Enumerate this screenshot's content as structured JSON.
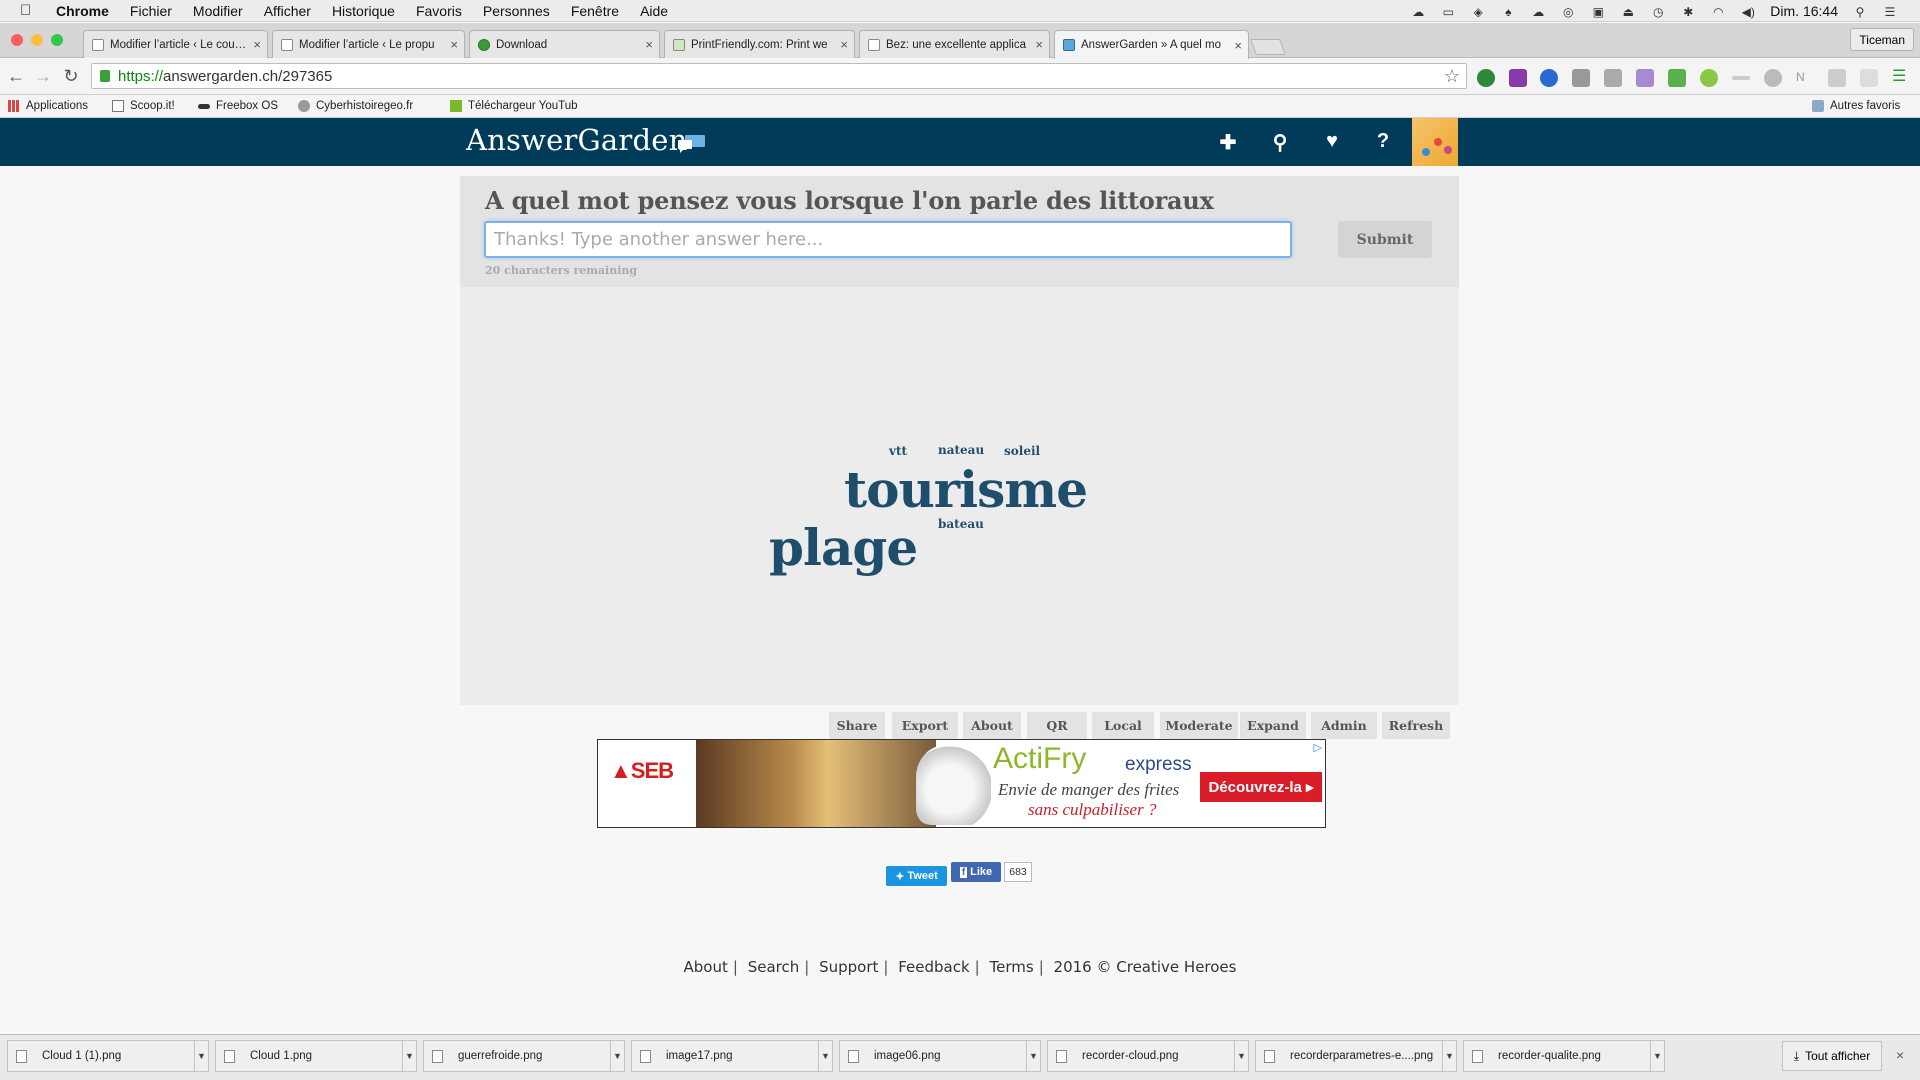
{
  "menubar": {
    "app": "Chrome",
    "items": [
      "Fichier",
      "Modifier",
      "Afficher",
      "Historique",
      "Favoris",
      "Personnes",
      "Fenêtre",
      "Aide"
    ],
    "clock": "Dim. 16:44"
  },
  "tabs": [
    {
      "title": "Modifier l’article ‹ Le coutea"
    },
    {
      "title": "Modifier l’article ‹ Le propu"
    },
    {
      "title": "Download"
    },
    {
      "title": "PrintFriendly.com: Print we"
    },
    {
      "title": "Bez: une excellente applica"
    },
    {
      "title": "AnswerGarden » A quel mo",
      "active": true
    }
  ],
  "profile": "Ticeman",
  "address": {
    "https": "https://",
    "rest": "answergarden.ch/297365"
  },
  "bookmarks": [
    "Applications",
    "Scoop.it!",
    "Freebox OS",
    "Cyberhistoiregeo.fr",
    "Téléchargeur YouTub",
    "Autres favoris"
  ],
  "site": {
    "brand": "AnswerGarden",
    "header_icons": [
      "plus-icon",
      "search-icon",
      "heart-icon",
      "help-icon"
    ],
    "header_glyphs": [
      "✚",
      "⚲",
      "♥",
      "?"
    ],
    "accent": "#003c5a"
  },
  "garden": {
    "question": "A quel mot pensez vous lorsque l'on parle des littoraux",
    "input_placeholder": "Thanks! Type another answer here...",
    "submit": "Submit",
    "remaining": "20 characters remaining"
  },
  "words": [
    {
      "text": "vtt",
      "weight": 1
    },
    {
      "text": "nateau",
      "weight": 1
    },
    {
      "text": "soleil",
      "weight": 1
    },
    {
      "text": "tourisme",
      "weight": 4
    },
    {
      "text": "bateau",
      "weight": 1
    },
    {
      "text": "plage",
      "weight": 4
    }
  ],
  "actions": [
    "Share",
    "Export",
    "About",
    "QR",
    "Local",
    "Moderate",
    "Expand",
    "Admin",
    "Refresh"
  ],
  "ad": {
    "brand": "▲SEB",
    "product_a": "ActiFry",
    "product_b": "express",
    "line1": "Envie de manger des frites",
    "line2": "sans culpabiliser ?",
    "cta": "Découvrez-la ▸"
  },
  "social": {
    "tweet": "Tweet",
    "like": "Like",
    "like_count": "683"
  },
  "footer": [
    "About",
    "Search",
    "Support",
    "Feedback",
    "Terms",
    "2016 © Creative Heroes"
  ],
  "downloads": [
    "Cloud 1 (1).png",
    "Cloud 1.png",
    "guerrefroide.png",
    "image17.png",
    "image06.png",
    "recorder-cloud.png",
    "recorderparametres-e....png",
    "recorder-qualite.png"
  ],
  "show_all": "Tout afficher"
}
